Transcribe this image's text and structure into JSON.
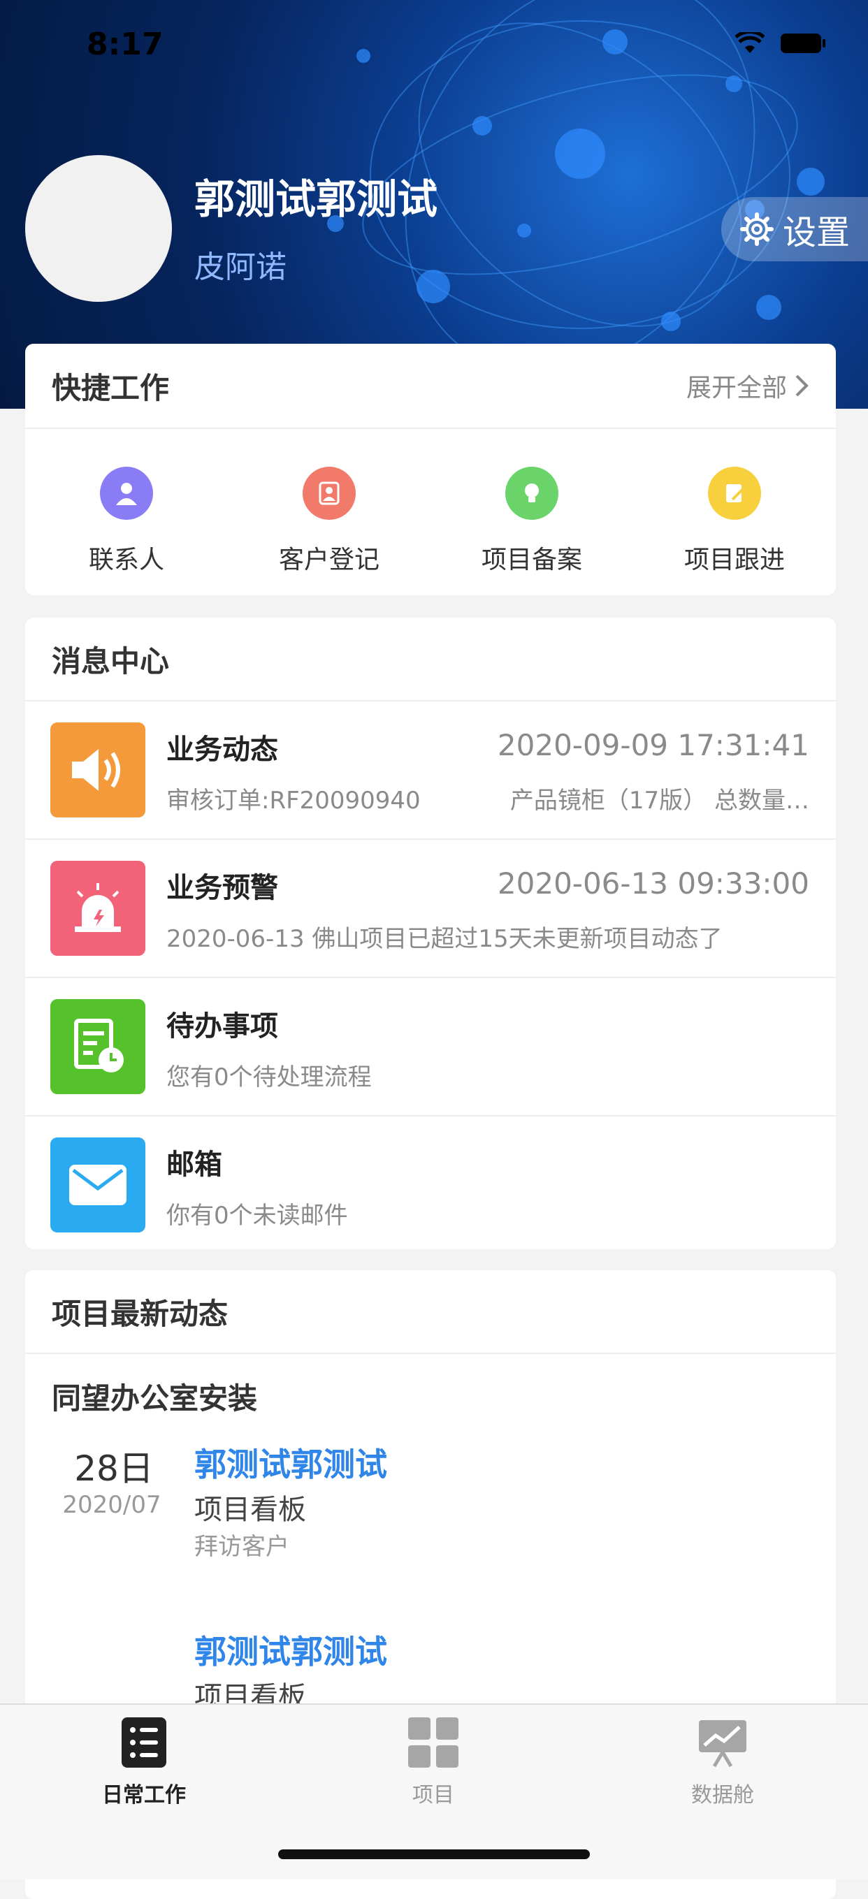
{
  "status": {
    "time": "8:17"
  },
  "profile": {
    "name": "郭测试郭测试",
    "subtitle": "皮阿诺",
    "settings_label": "设置"
  },
  "quick_work": {
    "title": "快捷工作",
    "expand_label": "展开全部",
    "items": [
      {
        "label": "联系人",
        "icon": "contact-icon",
        "color": "#8a7cf5"
      },
      {
        "label": "客户登记",
        "icon": "customer-register-icon",
        "color": "#f27a6b"
      },
      {
        "label": "项目备案",
        "icon": "lightbulb-icon",
        "color": "#6ad36a"
      },
      {
        "label": "项目跟进",
        "icon": "edit-note-icon",
        "color": "#f8cf3c"
      }
    ]
  },
  "messages": {
    "title": "消息中心",
    "rows": [
      {
        "title": "业务动态",
        "time": "2020-09-09 17:31:41",
        "desc": "审核订单:RF20090940",
        "desc2": "产品镜柜（17版）  总数量…",
        "icon": "speaker-icon",
        "color": "#f59a3b"
      },
      {
        "title": "业务预警",
        "time": "2020-06-13 09:33:00",
        "desc": "2020-06-13 佛山项目已超过15天未更新项目动态了",
        "desc2": "",
        "icon": "alarm-icon",
        "color": "#f2637a"
      },
      {
        "title": "待办事项",
        "time": "",
        "desc": "您有0个待处理流程",
        "desc2": "",
        "icon": "todo-doc-icon",
        "color": "#55c22c"
      },
      {
        "title": "邮箱",
        "time": "",
        "desc": "你有0个未读邮件",
        "desc2": "",
        "icon": "mail-icon",
        "color": "#2aaaf0"
      }
    ]
  },
  "project_news": {
    "title": "项目最新动态",
    "project_name": "同望办公室安装",
    "entries": [
      {
        "day": "28日",
        "month": "2020/07",
        "user": "郭测试郭测试",
        "kind": "项目看板",
        "action": "拜访客户"
      },
      {
        "user": "郭测试郭测试",
        "kind": "项目看板"
      }
    ]
  },
  "tabs": [
    {
      "label": "日常工作",
      "icon": "list-icon",
      "active": true
    },
    {
      "label": "项目",
      "icon": "grid-icon",
      "active": false
    },
    {
      "label": "数据舱",
      "icon": "chart-board-icon",
      "active": false
    }
  ]
}
